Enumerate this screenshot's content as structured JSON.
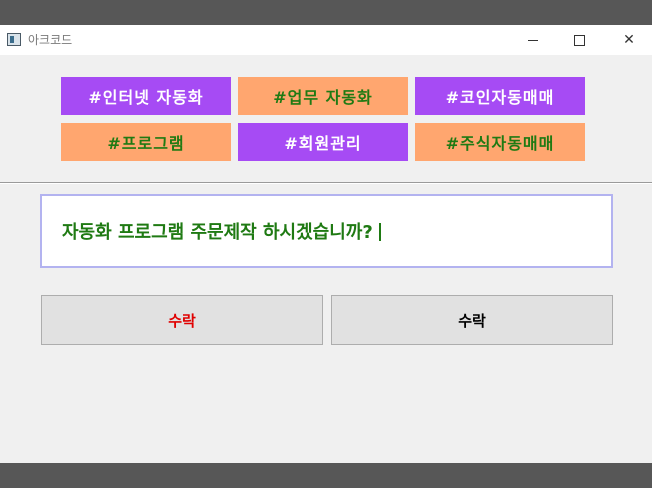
{
  "window": {
    "title": "아크코드"
  },
  "tags": [
    {
      "label": "#인터넷 자동화",
      "color": "#a64bf4"
    },
    {
      "label": "#업무 자동화",
      "color": "#ffa66f"
    },
    {
      "label": "#코인자동매매",
      "color": "#a64bf4"
    },
    {
      "label": "#프로그램",
      "color": "#ffa66f"
    },
    {
      "label": "#회원관리",
      "color": "#a64bf4"
    },
    {
      "label": "#주식자동매매",
      "color": "#ffa66f"
    }
  ],
  "prompt": {
    "text": "자동화 프로그램 주문제작 하시겠습니까?"
  },
  "buttons": {
    "left_label": "수락",
    "right_label": "수락"
  },
  "icons": {
    "app": "app-window-icon",
    "minimize": "minimize-icon",
    "maximize": "maximize-icon",
    "close": "close-icon"
  },
  "colors": {
    "purple": "#a64bf4",
    "orange": "#ffa66f",
    "green_text": "#1f7a13",
    "red_text": "#e00000"
  }
}
